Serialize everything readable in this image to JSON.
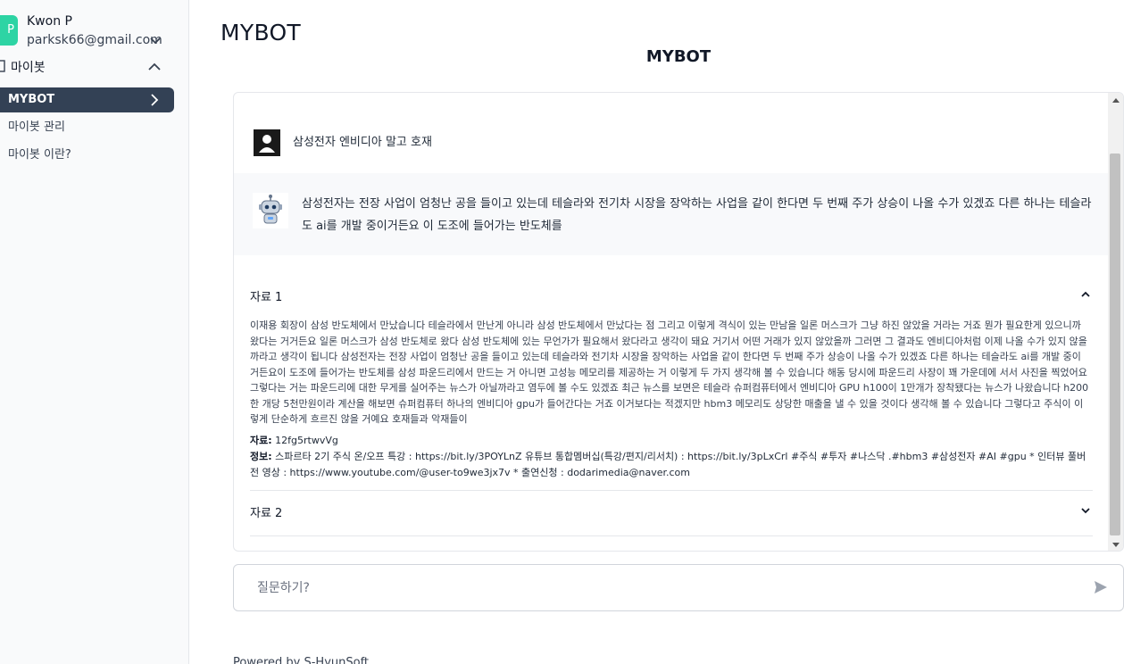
{
  "user": {
    "avatar_letter": "P",
    "name": "Kwon P",
    "email": "parksk66@gmail.com"
  },
  "sidebar": {
    "section_label": "마이봇",
    "items": [
      {
        "label": "MYBOT",
        "active": true
      },
      {
        "label": "마이봇 관리",
        "active": false
      },
      {
        "label": "마이봇 이란?",
        "active": false
      }
    ]
  },
  "page": {
    "title": "MYBOT",
    "bot_title": "MYBOT"
  },
  "chat": {
    "user_message": "삼성전자 엔비디아 말고 호재",
    "bot_message": "삼성전자는 전장 사업이 엄청난 공을 들이고 있는데 테슬라와 전기차 시장을 장악하는 사업을 같이 한다면 두 번째 주가 상승이 나올 수가 있겠죠 다른 하나는 테슬라도 ai를 개발 중이거든요 이 도조에 들어가는 반도체를",
    "sources": [
      {
        "title": "자료 1",
        "expanded": true,
        "body": "이재용 회장이 삼성 반도체에서 만났습니다 테슬라에서 만난게 아니라 삼성 반도체에서 만났다는 점 그리고 이렇게 격식이 있는 만남을 일론 머스크가 그냥 하진 않았을 거라는 거죠 뭔가 필요한게 있으니까 왔다는 거거든요 일론 머스크가 삼성 반도체로 왔다 삼성 반도체에 있는 무언가가 필요해서 왔다라고 생각이 돼요 거기서 어떤 거래가 있지 않았을까 그러면 그 결과도 엔비디아처럼 이제 나올 수가 있지 않을까라고 생각이 됩니다 삼성전자는 전장 사업이 엄청난 공을 들이고 있는데 테슬라와 전기차 시장을 장악하는 사업을 같이 한다면 두 번째 주가 상승이 나올 수가 있겠죠 다른 하나는 테슬라도 ai를 개발 중이거든요이 도조에 들어가는 반도체를 삼성 파운드리에서 만드는 거 아니면 고성능 메모리를 제공하는 거 이렇게 두 가지 생각해 볼 수 있습니다 해동 당시에 파운드리 사장이 꽤 가운데에 서서 사진을 찍었어요 그렇다는 거는 파운드리에 대한 무게를 실어주는 뉴스가 아닐까라고 염두에 볼 수도 있겠죠 최근 뉴스를 보면은 테슬라 슈퍼컴퓨터에서 엔비디아 GPU h100이 1만개가 장착됐다는 뉴스가 나왔습니다 h200 한 개당 5천만원이라 계산을 해보면 슈퍼컴퓨터 하나의 엔비디아 gpu가 들어간다는 거죠 이거보다는 적겠지만 hbm3 메모리도 상당한 매출을 낼 수 있을 것이다 생각해 볼 수 있습니다 그렇다고 주식이 이렇게 단순하게 흐르진 않을 거예요 호재들과 악재들이",
        "source_label": "자료:",
        "source_value": "12fg5rtwvVg",
        "info_label": "정보:",
        "info_value": "스파르타 2기 주식 온/오프 특강 : https://bit.ly/3POYLnZ 유튜브 통합멤버십(특강/편지/리서치) : https://bit.ly/3pLxCrl #주식 #투자 #나스닥 .#hbm3 #삼성전자 #AI #gpu * 인터뷰 풀버전 영상 : https://www.youtube.com/@user-to9we3jx7v * 출연신청 : dodarimedia@naver.com"
      },
      {
        "title": "자료 2",
        "expanded": false
      }
    ]
  },
  "input": {
    "placeholder": "질문하기?"
  },
  "footer": {
    "text": "Powered by S-HyunSoft"
  },
  "colors": {
    "active_nav_bg": "#334155",
    "avatar_bg": "#2dd4a4",
    "bot_message_bg": "#f8f9fb"
  }
}
